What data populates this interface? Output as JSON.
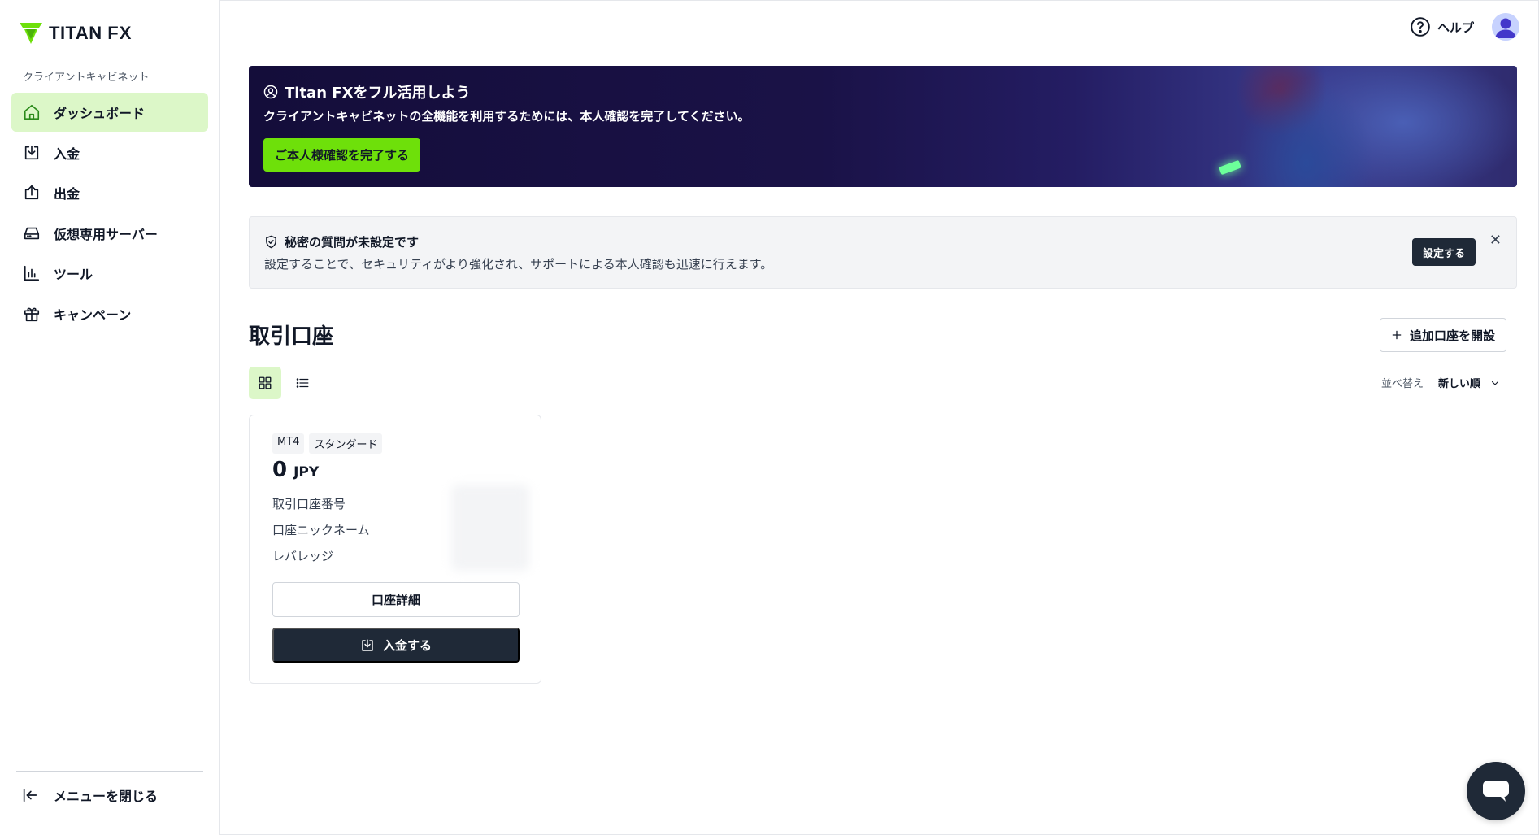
{
  "brand": {
    "logo_text": "TITAN",
    "logo_fx": "FX"
  },
  "sidebar": {
    "section_label": "クライアントキャビネット",
    "items": [
      {
        "label": "ダッシュボード",
        "icon": "home-icon",
        "active": true
      },
      {
        "label": "入金",
        "icon": "deposit-icon",
        "active": false
      },
      {
        "label": "出金",
        "icon": "withdraw-icon",
        "active": false
      },
      {
        "label": "仮想専用サーバー",
        "icon": "server-icon",
        "active": false
      },
      {
        "label": "ツール",
        "icon": "chart-bars-icon",
        "active": false
      },
      {
        "label": "キャンペーン",
        "icon": "gift-icon",
        "active": false
      }
    ],
    "collapse_label": "メニューを閉じる"
  },
  "topbar": {
    "help_label": "ヘルプ"
  },
  "banner": {
    "title": "Titan FXをフル活用しよう",
    "subtitle": "クライアントキャビネットの全機能を利用するためには、本人確認を完了してください。",
    "button_label": "ご本人様確認を完了する"
  },
  "alert": {
    "title": "秘密の質問が未設定です",
    "description": "設定することで、セキュリティがより強化され、サポートによる本人確認も迅速に行えます。",
    "button_label": "設定する",
    "close_glyph": "✕"
  },
  "accounts": {
    "title": "取引口座",
    "add_button_label": "追加口座を開設",
    "sort_label": "並べ替え",
    "sort_value": "新しい順",
    "card": {
      "platform_tag": "MT4",
      "type_tag": "スタンダード",
      "balance": "0",
      "currency": "JPY",
      "field_account_number": "取引口座番号",
      "field_nickname": "口座ニックネーム",
      "field_leverage": "レバレッジ",
      "detail_button_label": "口座詳細",
      "deposit_button_label": "入金する"
    }
  },
  "colors": {
    "accent_green": "#6ee00a",
    "active_bg": "#dcf7c8",
    "dark_button": "#1f2937",
    "banner_bg": "#140d3a"
  }
}
